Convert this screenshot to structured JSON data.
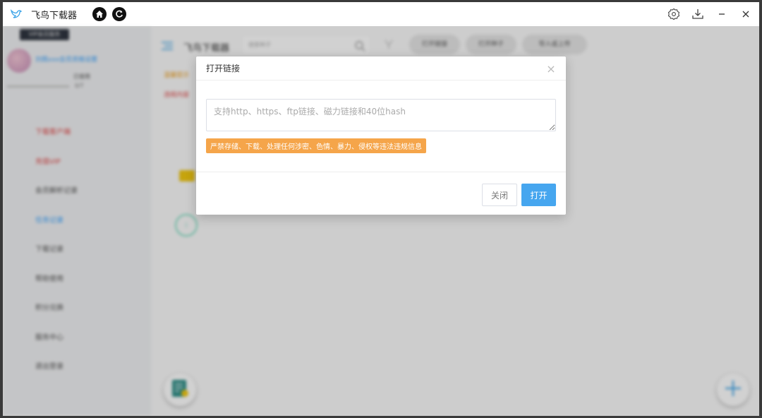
{
  "window": {
    "title": "飞鸟下载器"
  },
  "sidebar": {
    "top_badge": "VIP会员服务",
    "username": "刘佩xxx会员资格设置",
    "quota": "已使用",
    "bar_label": "0/T",
    "items": [
      {
        "label": "下载客户端"
      },
      {
        "label": "充值VIP"
      },
      {
        "label": "会员解析记录"
      },
      {
        "label": "任务记录"
      },
      {
        "label": "下载记录"
      },
      {
        "label": "帮助使用"
      },
      {
        "label": "积分兑换"
      },
      {
        "label": "服务中心"
      },
      {
        "label": "退出登录"
      }
    ]
  },
  "main": {
    "title": "飞鸟下载器",
    "search_placeholder": "搜索种子",
    "pills": [
      "打开链接",
      "打开种子",
      "导入或上传"
    ],
    "warn_line1": "温馨提示",
    "warn_line2": "违规内容"
  },
  "dialog": {
    "title": "打开链接",
    "close_x": "×",
    "textarea_placeholder": "支持http、https、ftp链接、磁力链接和40位hash",
    "warning": "严禁存储、下载、处理任何涉密、色情、暴力、侵权等违法违规信息",
    "cancel_label": "关闭",
    "open_label": "打开"
  },
  "colors": {
    "accent": "#46a6ef",
    "warning_bg": "#f5a54a"
  }
}
